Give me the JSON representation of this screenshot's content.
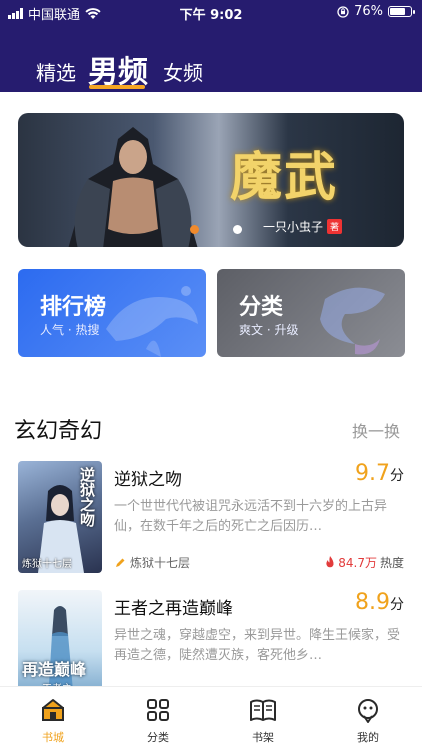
{
  "status_bar": {
    "carrier": "中国联通",
    "time": "下午 9:02",
    "battery": "76%",
    "battery_level": 0.76
  },
  "top_tabs": [
    {
      "label": "精选",
      "active": false
    },
    {
      "label": "男频",
      "active": true
    },
    {
      "label": "女频",
      "active": false
    }
  ],
  "banner": {
    "title": "魔武",
    "author": "一只小虫子",
    "author_badge": "著",
    "slide_count": 2,
    "active_slide": 0
  },
  "quick_cards": [
    {
      "title": "排行榜",
      "subtitle": "人气 · 热搜",
      "color": "#2c6bf0"
    },
    {
      "title": "分类",
      "subtitle": "爽文 · 升级",
      "color": "#6e7077"
    }
  ],
  "section": {
    "title": "玄幻奇幻",
    "more_label": "换一换"
  },
  "books": [
    {
      "cover_text": "逆狱之吻",
      "cover_author": "炼狱十七层",
      "title": "逆狱之吻",
      "score": "9.7",
      "score_unit": "分",
      "description": "一个世世代代被诅咒永远活不到十六岁的上古异仙，在数千年之后的死亡之后因历…",
      "author": "炼狱十七层",
      "heat_value": "84.7万",
      "heat_label": "热度"
    },
    {
      "cover_text": "再造巅峰",
      "cover_author": "王者之",
      "title": "王者之再造巅峰",
      "score": "8.9",
      "score_unit": "分",
      "description": "异世之魂，穿越虚空，来到异世。降生王候家，受再造之德，陡然遭灭族，客死他乡…"
    }
  ],
  "tab_bar": [
    {
      "label": "书城",
      "icon": "home-icon",
      "active": true
    },
    {
      "label": "分类",
      "icon": "grid-icon",
      "active": false
    },
    {
      "label": "书架",
      "icon": "book-icon",
      "active": false
    },
    {
      "label": "我的",
      "icon": "profile-icon",
      "active": false
    }
  ],
  "colors": {
    "header_bg": "#261c6f",
    "accent": "#f0a21c",
    "hot": "#e23b3b"
  }
}
